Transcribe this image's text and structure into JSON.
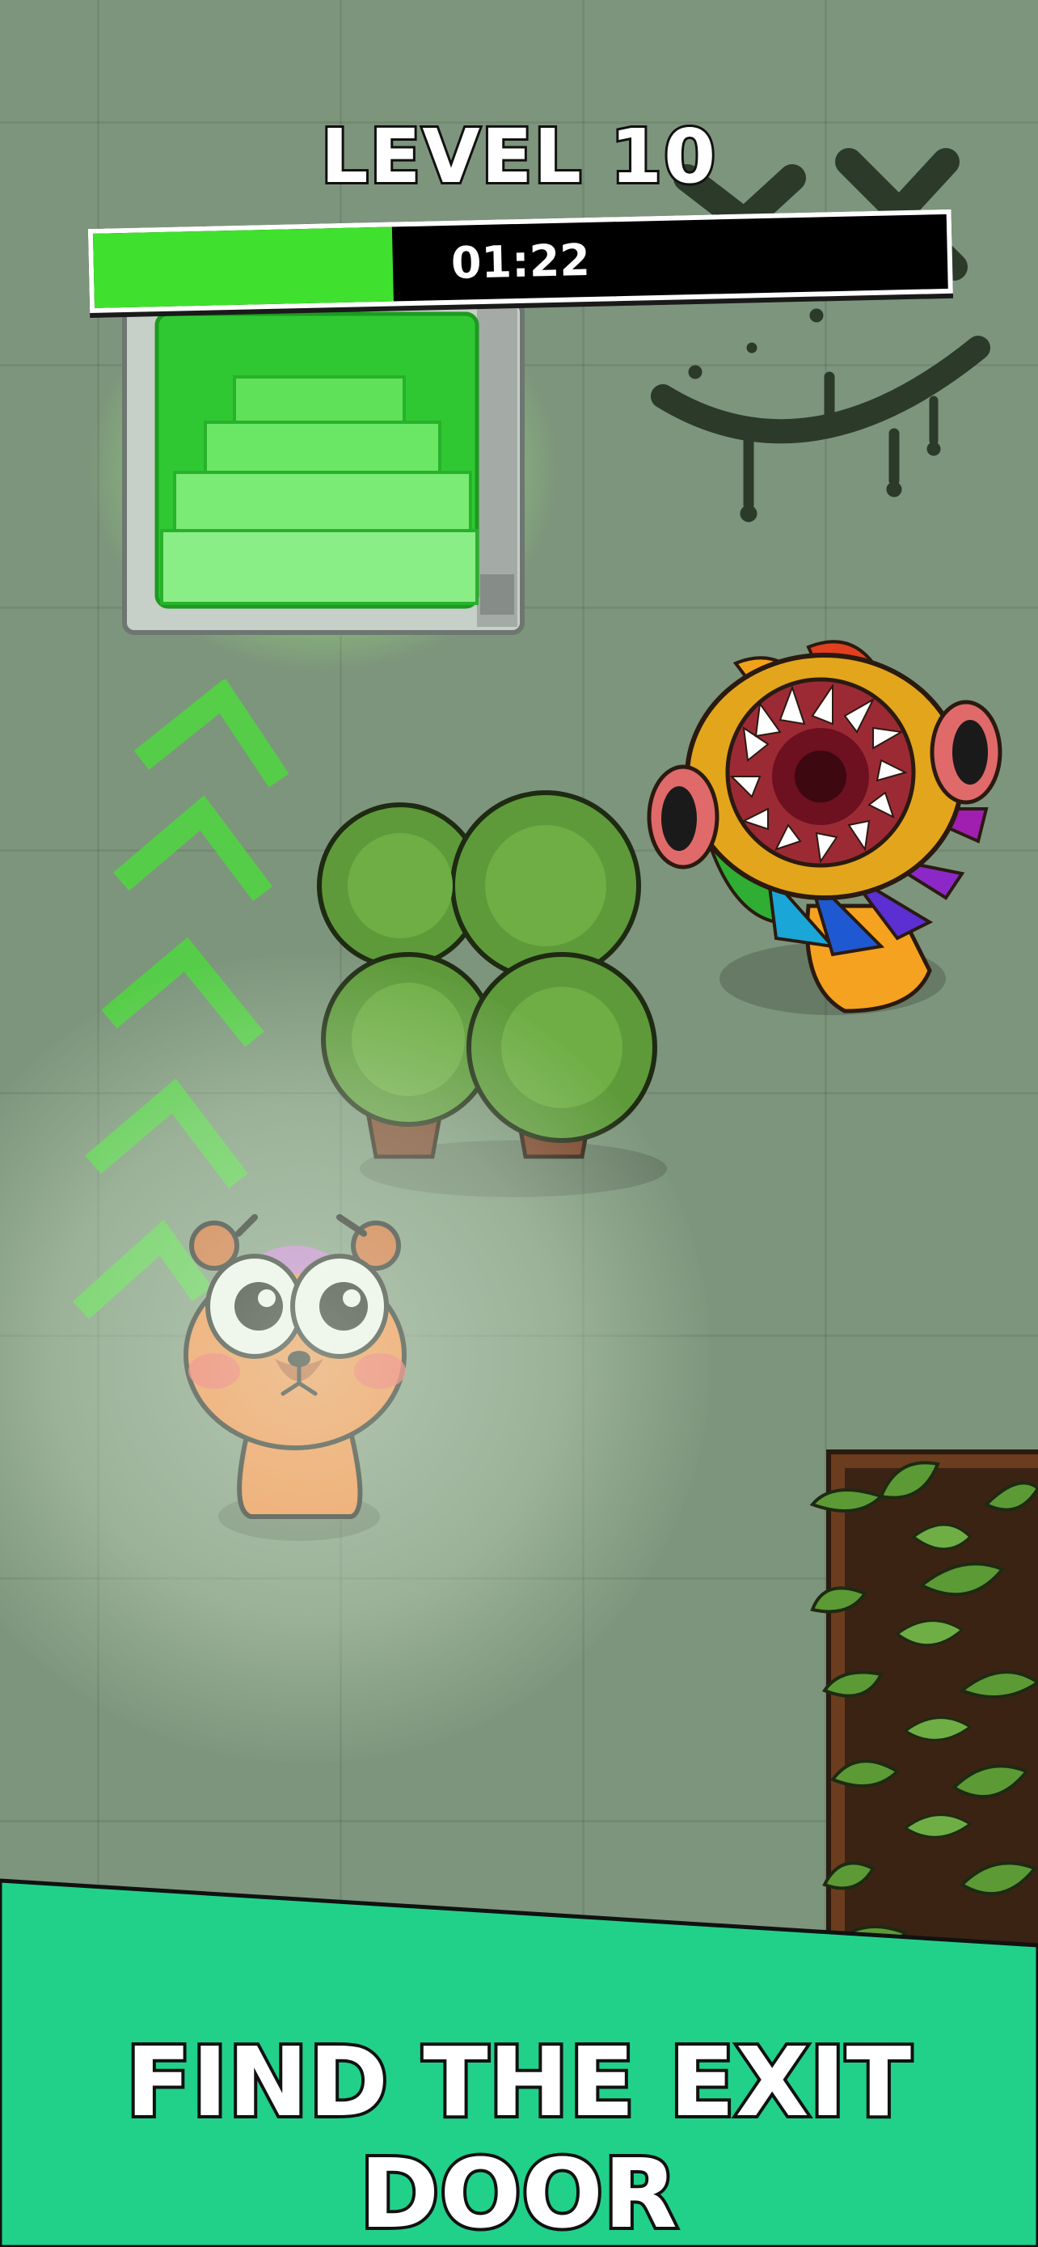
{
  "hud": {
    "level_label": "LEVEL 10",
    "timer": "01:22",
    "timer_progress": 0.35,
    "timer_fill_color": "#3fe12e"
  },
  "instruction": {
    "text": "FIND THE EXIT DOOR",
    "banner_color": "#21d18a"
  },
  "scene": {
    "exit_door": {
      "glow_color": "#9cff73",
      "icon": "stairs-exit-icon"
    },
    "guide_arrows": {
      "count": 5,
      "icon": "chevron-up-icon",
      "color": "#4cd63f"
    },
    "player": {
      "icon": "orange-bear-character"
    },
    "monster": {
      "icon": "rainbow-monster"
    },
    "wall_graffiti": {
      "icon": "smiley-graffiti-icon"
    },
    "plants": {
      "bush_count": 4,
      "planter_icon": "leafy-planter-icon"
    }
  }
}
